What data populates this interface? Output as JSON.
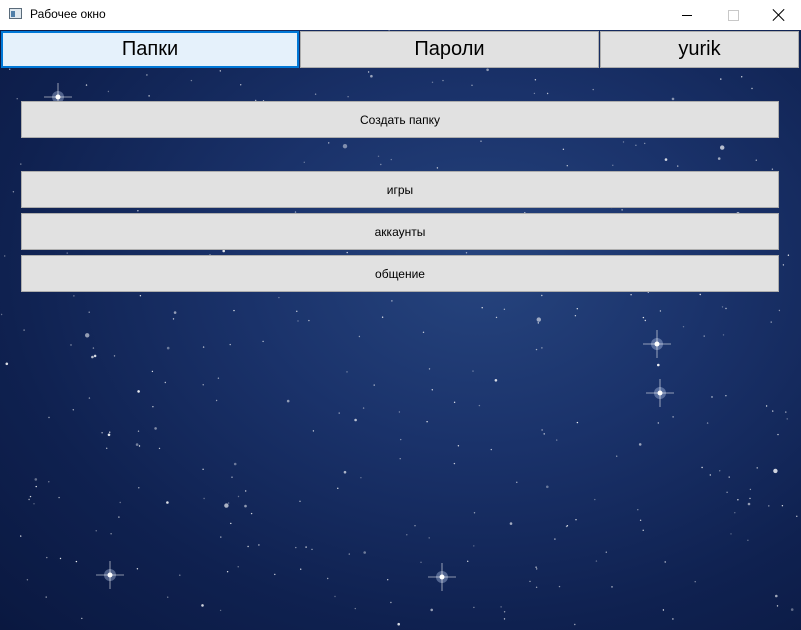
{
  "window": {
    "title": "Рабочее окно",
    "icon": "app-window-icon"
  },
  "tabs": [
    {
      "label": "Папки",
      "active": true
    },
    {
      "label": "Пароли",
      "active": false
    },
    {
      "label": "yurik",
      "active": false
    }
  ],
  "actions": {
    "create_folder_label": "Создать папку"
  },
  "folders": [
    {
      "label": "игры"
    },
    {
      "label": "аккаунты"
    },
    {
      "label": "общение"
    }
  ],
  "colors": {
    "accent": "#0078d7",
    "button_bg": "#e1e1e1",
    "active_tab_bg": "#e5f1fb",
    "background_space": "#1a326a"
  }
}
